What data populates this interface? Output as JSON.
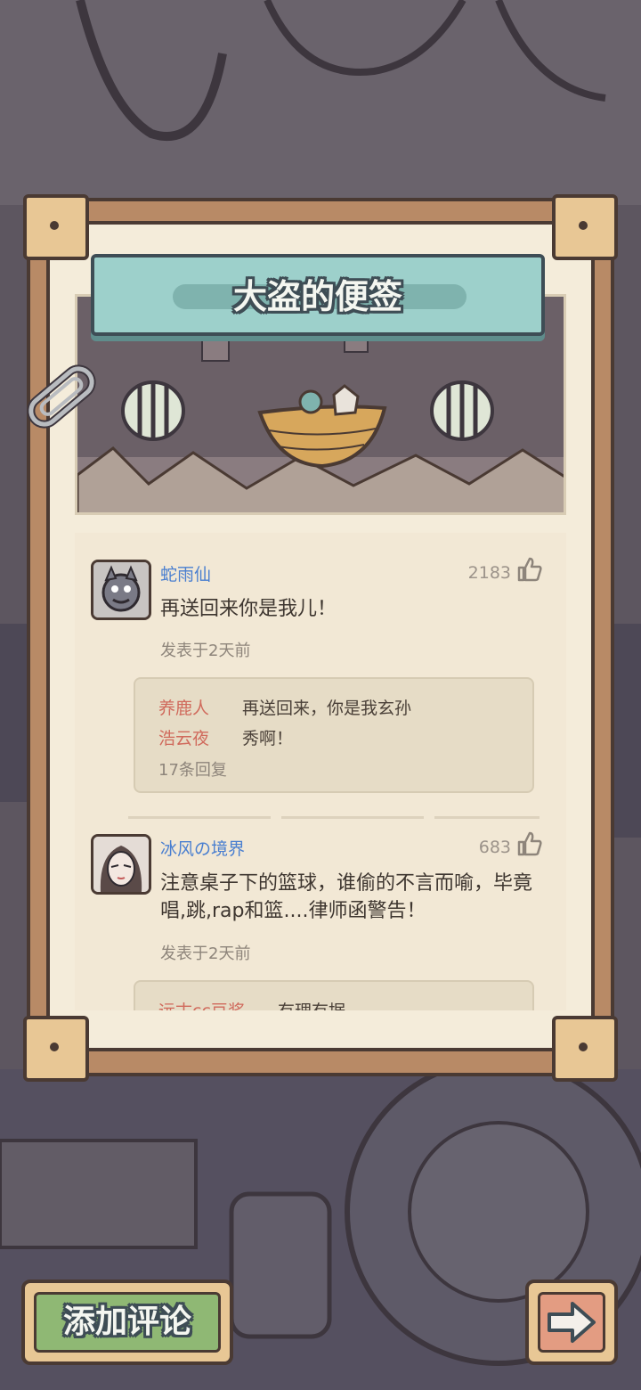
{
  "title": "大盗的便签",
  "comments": [
    {
      "user": "蛇雨仙",
      "likes": "2183",
      "text": "再送回来你是我儿！",
      "time": "发表于2天前",
      "replies": [
        {
          "user": "养鹿人",
          "text": "再送回来，你是我玄孙"
        },
        {
          "user": "浩云夜",
          "text": "秀啊！"
        }
      ],
      "reply_count": "17条回复"
    },
    {
      "user": "冰风の境界",
      "likes": "683",
      "text": "注意桌子下的篮球，谁偷的不言而喻，毕竟唱,跳,rap和篮....律师函警告！",
      "time": "发表于2天前",
      "replies": [
        {
          "user": "远古cc豆浆",
          "text": "有理有据"
        }
      ]
    }
  ],
  "buttons": {
    "add_comment": "添加评论"
  },
  "icons": {
    "like": "thumbs-up-icon",
    "next": "arrow-right-icon",
    "clip": "paperclip-icon"
  },
  "colors": {
    "username": "#4a7fd0",
    "reply_username": "#d06a5c",
    "paper": "#f4ecda",
    "banner": "#9dd0cb",
    "add_button": "#8fb874",
    "next_button": "#e39c82"
  }
}
